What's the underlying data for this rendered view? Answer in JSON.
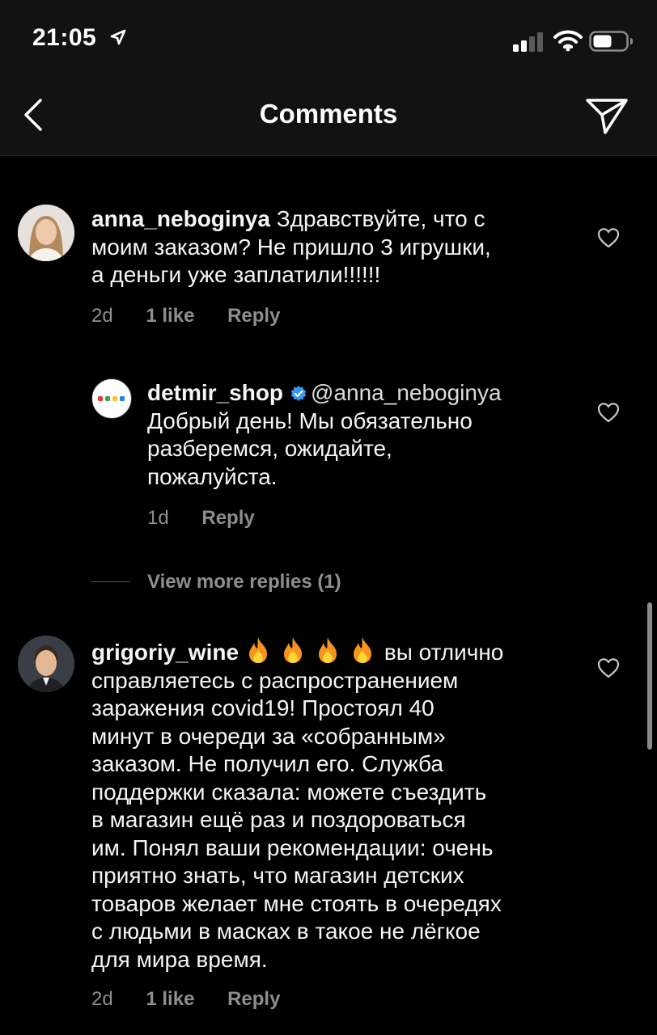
{
  "status_bar": {
    "time": "21:05"
  },
  "nav": {
    "title": "Comments"
  },
  "comments": [
    {
      "username": "anna_neboginya",
      "text_lines": [
        "Здравствуйте, что с",
        "моим заказом? Не пришло 3 игрушки,",
        "а деньги уже заплатили!!!!!!"
      ],
      "age": "2d",
      "likes": "1 like",
      "reply": "Reply"
    },
    {
      "username": "detmir_shop",
      "mention": "@anna_neboginya",
      "text_lines": [
        "Добрый день! Мы обязательно",
        "разберемся, ожидайте,",
        "пожалуйста."
      ],
      "age": "1d",
      "reply": "Reply"
    },
    {
      "username": "grigoriy_wine",
      "emoji": [
        "🔥",
        "🔥",
        "🔥",
        "🔥"
      ],
      "text_lines": [
        "вы отлично",
        "справляетесь с распространением",
        "заражения covid19! Простоял 40",
        "минут в очереди за «собранным»",
        "заказом. Не получил его. Служба",
        "поддержки сказала: можете съездить",
        "в магазин ещё раз и поздороваться",
        "им. Понял ваши рекомендации: очень",
        "приятно знать, что магазин детских",
        "товаров желает мне стоять в очередях",
        "с людьми в масках в такое не лёгкое",
        "для мира время."
      ],
      "age": "2d",
      "likes": "1 like",
      "reply": "Reply"
    }
  ],
  "view_more": "View more replies (1)",
  "colors": {
    "background": "#000000",
    "bar": "#121212",
    "muted": "#8e8e8e",
    "verified": "#3897f0"
  }
}
